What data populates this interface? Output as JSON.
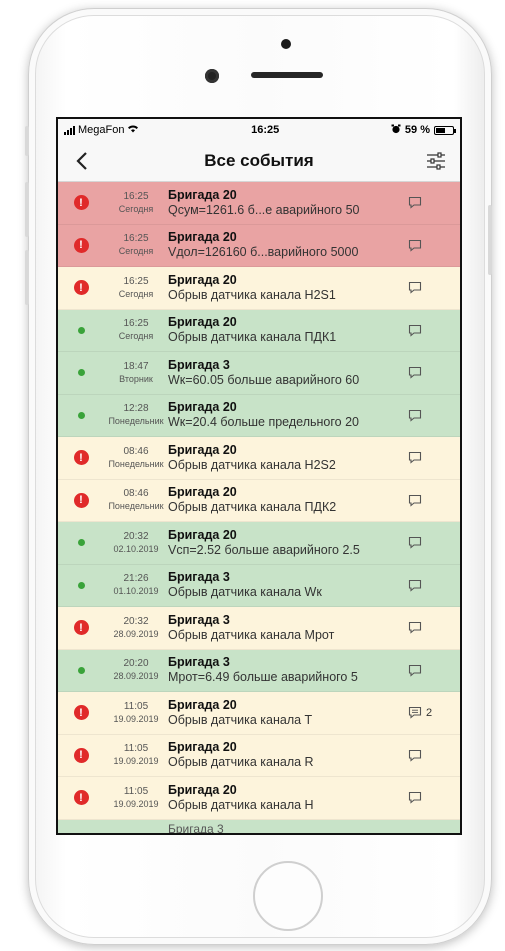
{
  "status_bar": {
    "carrier": "MegaFon",
    "time": "16:25",
    "battery": "59 %",
    "battery_level": 0.59
  },
  "nav": {
    "title": "Все события",
    "back_icon": "chevron-left-icon",
    "filter_icon": "sliders-icon"
  },
  "events": [
    {
      "severity": "alarm",
      "bg": "red",
      "time": "16:25",
      "date": "Сегодня",
      "title": "Бригада 20",
      "message": "Qсум=1261.6 б...е аварийного 50",
      "comments": ""
    },
    {
      "severity": "alarm",
      "bg": "red",
      "time": "16:25",
      "date": "Сегодня",
      "title": "Бригада 20",
      "message": "Vдол=126160 б...варийного 5000",
      "comments": ""
    },
    {
      "severity": "alarm",
      "bg": "yellow",
      "time": "16:25",
      "date": "Сегодня",
      "title": "Бригада 20",
      "message": "Обрыв датчика канала H2S1",
      "comments": ""
    },
    {
      "severity": "ok",
      "bg": "green",
      "time": "16:25",
      "date": "Сегодня",
      "title": "Бригада 20",
      "message": "Обрыв датчика канала ПДК1",
      "comments": ""
    },
    {
      "severity": "ok",
      "bg": "green",
      "time": "18:47",
      "date": "Вторник",
      "title": "Бригада 3",
      "message": "Wк=60.05 больше аварийного 60",
      "comments": ""
    },
    {
      "severity": "ok",
      "bg": "green",
      "time": "12:28",
      "date": "Понедельник",
      "title": "Бригада 20",
      "message": "Wк=20.4 больше предельного 20",
      "comments": ""
    },
    {
      "severity": "alarm",
      "bg": "yellow",
      "time": "08:46",
      "date": "Понедельник",
      "title": "Бригада 20",
      "message": "Обрыв датчика канала H2S2",
      "comments": ""
    },
    {
      "severity": "alarm",
      "bg": "yellow",
      "time": "08:46",
      "date": "Понедельник",
      "title": "Бригада 20",
      "message": "Обрыв датчика канала ПДК2",
      "comments": ""
    },
    {
      "severity": "ok",
      "bg": "green",
      "time": "20:32",
      "date": "02.10.2019",
      "title": "Бригада 20",
      "message": "Vсп=2.52 больше аварийного 2.5",
      "comments": ""
    },
    {
      "severity": "ok",
      "bg": "green",
      "time": "21:26",
      "date": "01.10.2019",
      "title": "Бригада 3",
      "message": "Обрыв датчика канала Wк",
      "comments": ""
    },
    {
      "severity": "alarm",
      "bg": "yellow",
      "time": "20:32",
      "date": "28.09.2019",
      "title": "Бригада 3",
      "message": "Обрыв датчика канала Mрот",
      "comments": ""
    },
    {
      "severity": "ok",
      "bg": "green",
      "time": "20:20",
      "date": "28.09.2019",
      "title": "Бригада 3",
      "message": "Mрот=6.49 больше аварийного 5",
      "comments": ""
    },
    {
      "severity": "alarm",
      "bg": "yellow",
      "time": "11:05",
      "date": "19.09.2019",
      "title": "Бригада 20",
      "message": "Обрыв датчика канала T",
      "comments": "2"
    },
    {
      "severity": "alarm",
      "bg": "yellow",
      "time": "11:05",
      "date": "19.09.2019",
      "title": "Бригада 20",
      "message": "Обрыв датчика канала R",
      "comments": ""
    },
    {
      "severity": "alarm",
      "bg": "yellow",
      "time": "11:05",
      "date": "19.09.2019",
      "title": "Бригада 20",
      "message": "Обрыв датчика канала H",
      "comments": ""
    }
  ],
  "partial_row": {
    "title": "Бригада 3"
  }
}
